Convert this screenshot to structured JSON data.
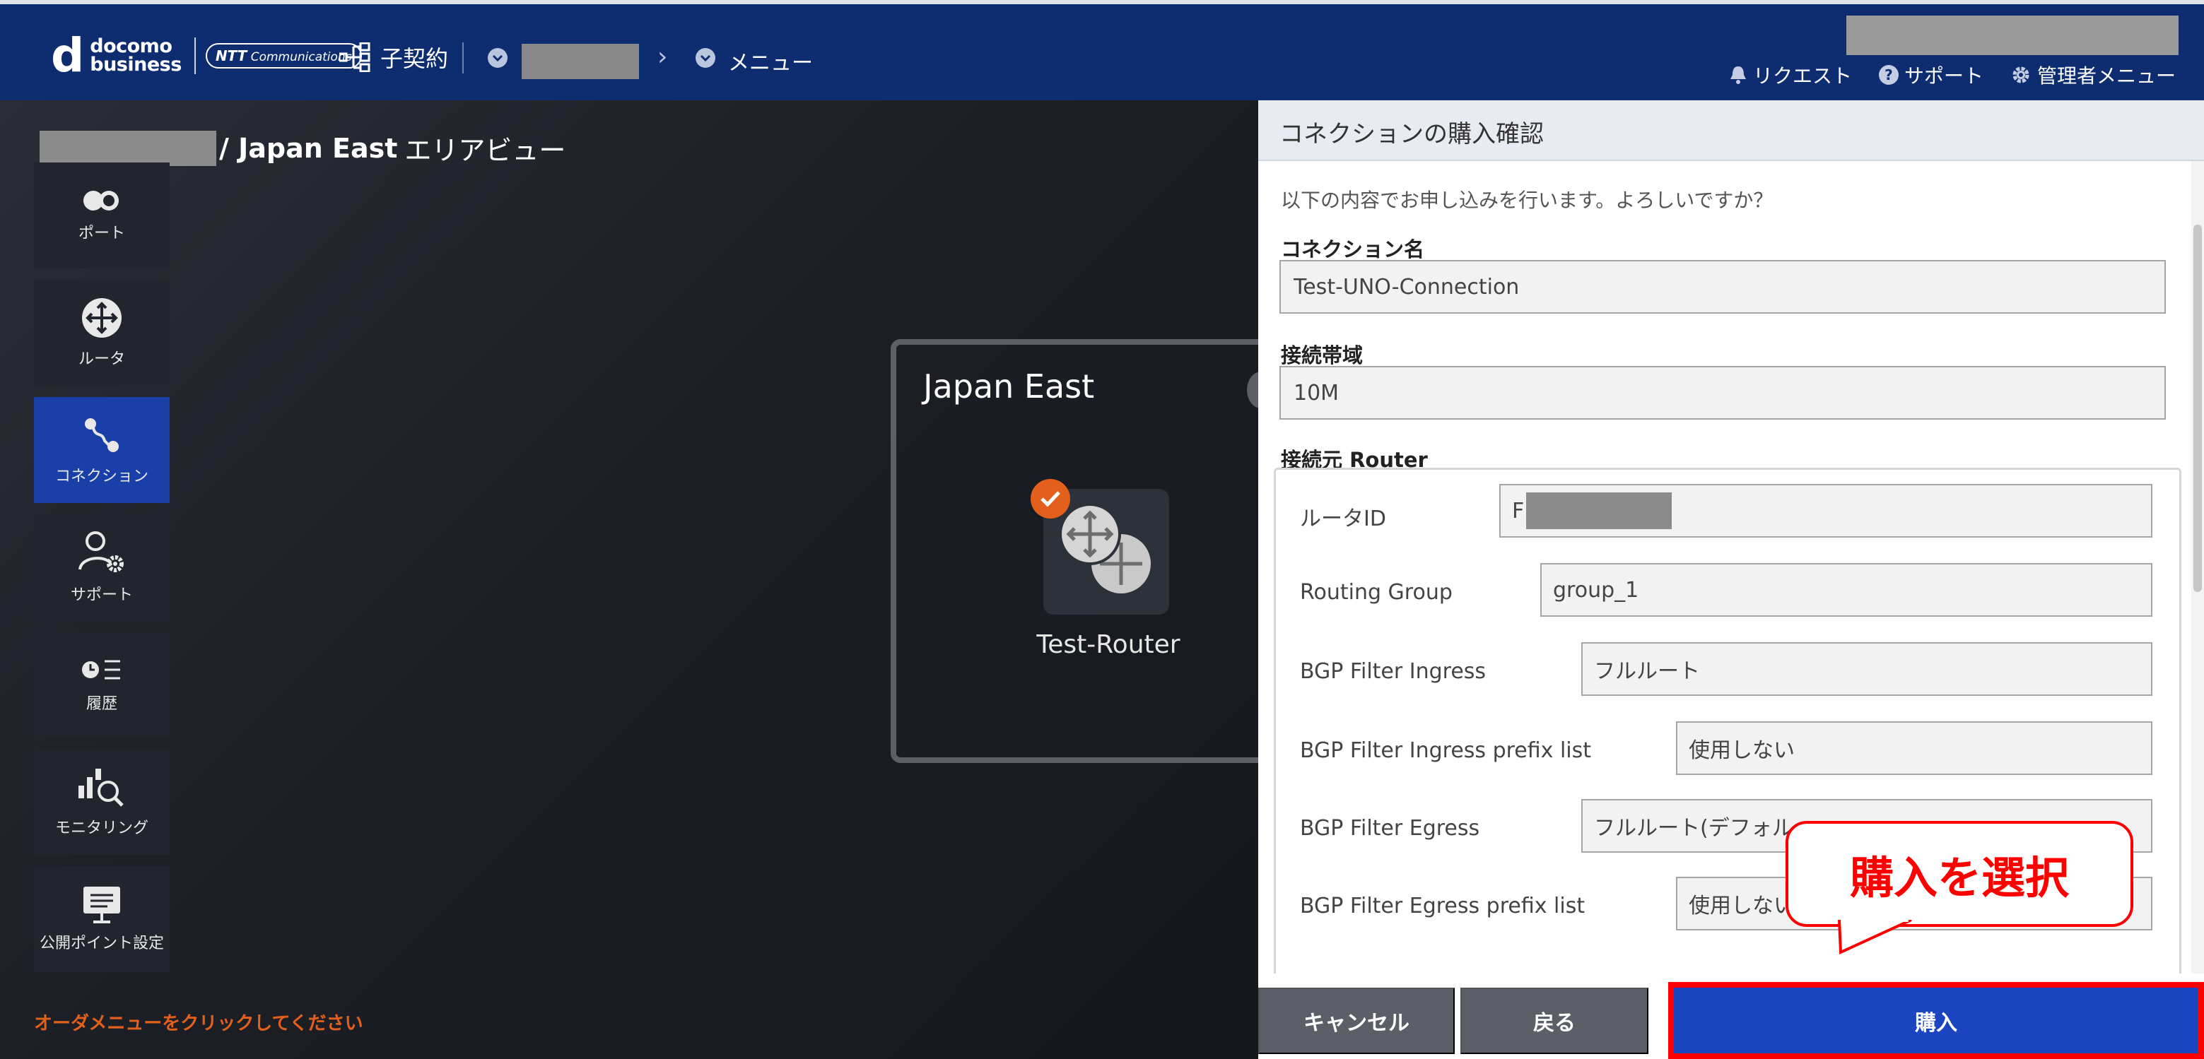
{
  "header": {
    "logo_brand": "docomo business",
    "logo_d": "d",
    "logo_line1": "docomo",
    "logo_line2": "business",
    "logo_partner": "NTT Communications",
    "contract_label": "子契約",
    "menu_label": "メニュー",
    "links": [
      {
        "icon": "bell-icon",
        "label": "リクエスト"
      },
      {
        "icon": "question-icon",
        "label": "サポート"
      },
      {
        "icon": "gear-icon",
        "label": "管理者メニュー"
      }
    ]
  },
  "canvas": {
    "title_main": "/ Japan East",
    "title_suffix": "エリアビュー",
    "sidebar": [
      {
        "icon": "port-icon",
        "label": "ポート"
      },
      {
        "icon": "router-icon",
        "label": "ルータ"
      },
      {
        "icon": "connection-icon",
        "label": "コネクション",
        "active": true
      },
      {
        "icon": "support-icon",
        "label": "サポート"
      },
      {
        "icon": "history-icon",
        "label": "履歴"
      },
      {
        "icon": "monitoring-icon",
        "label": "モニタリング"
      },
      {
        "icon": "public-point-icon",
        "label": "公開ポイント設定"
      }
    ],
    "order_message": "オーダメニューをクリックしてください",
    "region_title": "Japan East",
    "router_label": "Test-Router"
  },
  "dialog": {
    "title": "コネクションの購入確認",
    "intro": "以下の内容でお申し込みを行います。よろしいですか？",
    "connection_name_label": "コネクション名",
    "connection_name_value": "Test-UNO-Connection",
    "bandwidth_label": "接続帯域",
    "bandwidth_value": "10M",
    "source_router_label": "接続元 Router",
    "router_rows": [
      {
        "label": "ルータID",
        "value": "F"
      },
      {
        "label": "Routing Group",
        "value": "group_1"
      },
      {
        "label": "BGP Filter Ingress",
        "value": "フルルート"
      },
      {
        "label": "BGP Filter Ingress prefix list",
        "value": "使用しない"
      },
      {
        "label": "BGP Filter Egress",
        "value": "フルルート(デフォル"
      },
      {
        "label": "BGP Filter Egress prefix list",
        "value": "使用しない"
      }
    ],
    "buttons": {
      "cancel": "キャンセル",
      "back": "戻る",
      "purchase": "購入"
    }
  },
  "annotation": {
    "callout": "購入を選択",
    "highlight_color": "#ff0000"
  },
  "colors": {
    "header_bg": "#0e2c70",
    "active_nav": "#1b3fa8",
    "purchase_button": "#1b44c0",
    "accent_orange": "#e2601b"
  }
}
